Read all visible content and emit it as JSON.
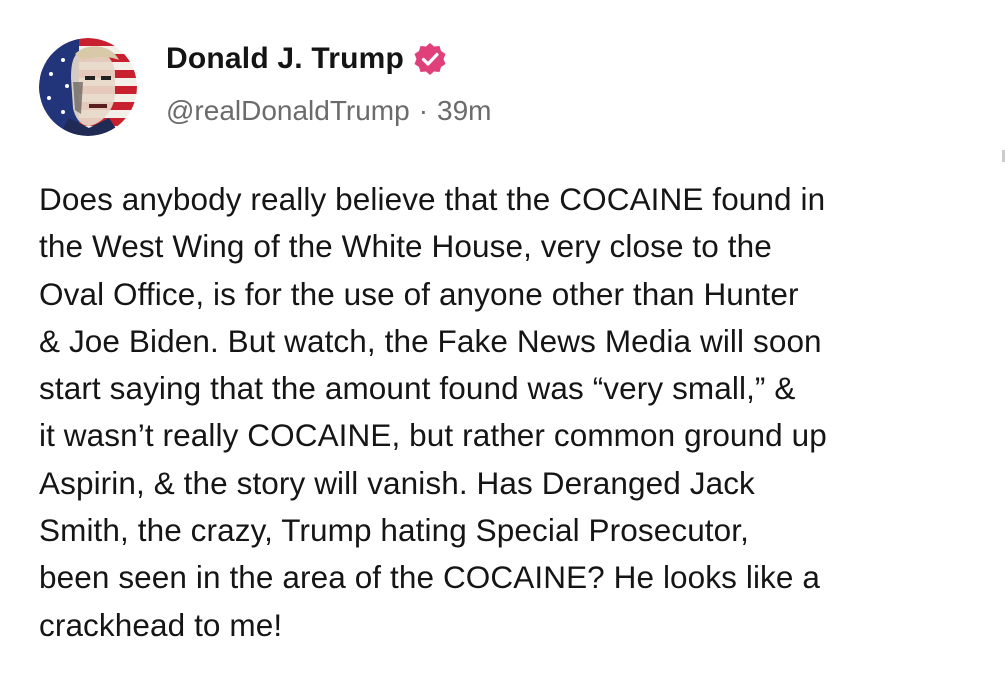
{
  "author": {
    "display_name": "Donald J. Trump",
    "handle": "@realDonaldTrump",
    "separator": "·",
    "time": "39m",
    "verified_icon": "verified-badge-icon",
    "verified_color": "#e0407a",
    "avatar_icon": "profile-portrait-flag"
  },
  "post": {
    "lines": [
      "Does anybody really believe that the COCAINE found in",
      "the West Wing of the White House, very close to the",
      "Oval Office, is for the use of anyone other than Hunter",
      "& Joe Biden. But watch, the Fake News Media will soon",
      "start saying that the amount found was “very small,” &",
      "it wasn’t really COCAINE, but rather common ground up",
      "Aspirin, & the story will vanish. Has Deranged Jack",
      "Smith, the crazy, Trump hating Special Prosecutor,",
      "been seen in the area of the COCAINE? He looks like a",
      "crackhead to me!"
    ]
  }
}
